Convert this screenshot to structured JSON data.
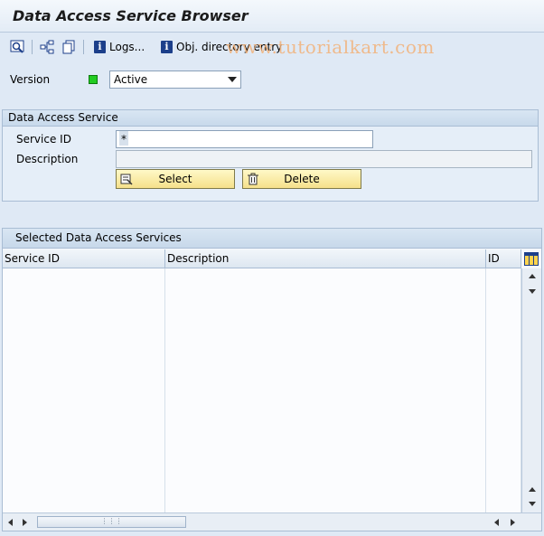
{
  "header": {
    "title": "Data Access Service Browser"
  },
  "toolbar": {
    "logs_label": "Logs...",
    "obj_dir_label": "Obj. directory entry",
    "watermark": "www.tutorialkart.com"
  },
  "version": {
    "label": "Version",
    "selected": "Active",
    "status_color": "#22cc22"
  },
  "das_group": {
    "title": "Data Access Service",
    "service_id_label": "Service ID",
    "service_id_value": "*",
    "description_label": "Description",
    "description_value": "",
    "select_label": "Select",
    "delete_label": "Delete"
  },
  "table": {
    "title": "Selected Data Access Services",
    "columns": [
      "Service ID",
      "Description",
      "ID"
    ],
    "rows": []
  },
  "colors": {
    "background": "#dfe9f5",
    "button": "#f5e08a"
  }
}
